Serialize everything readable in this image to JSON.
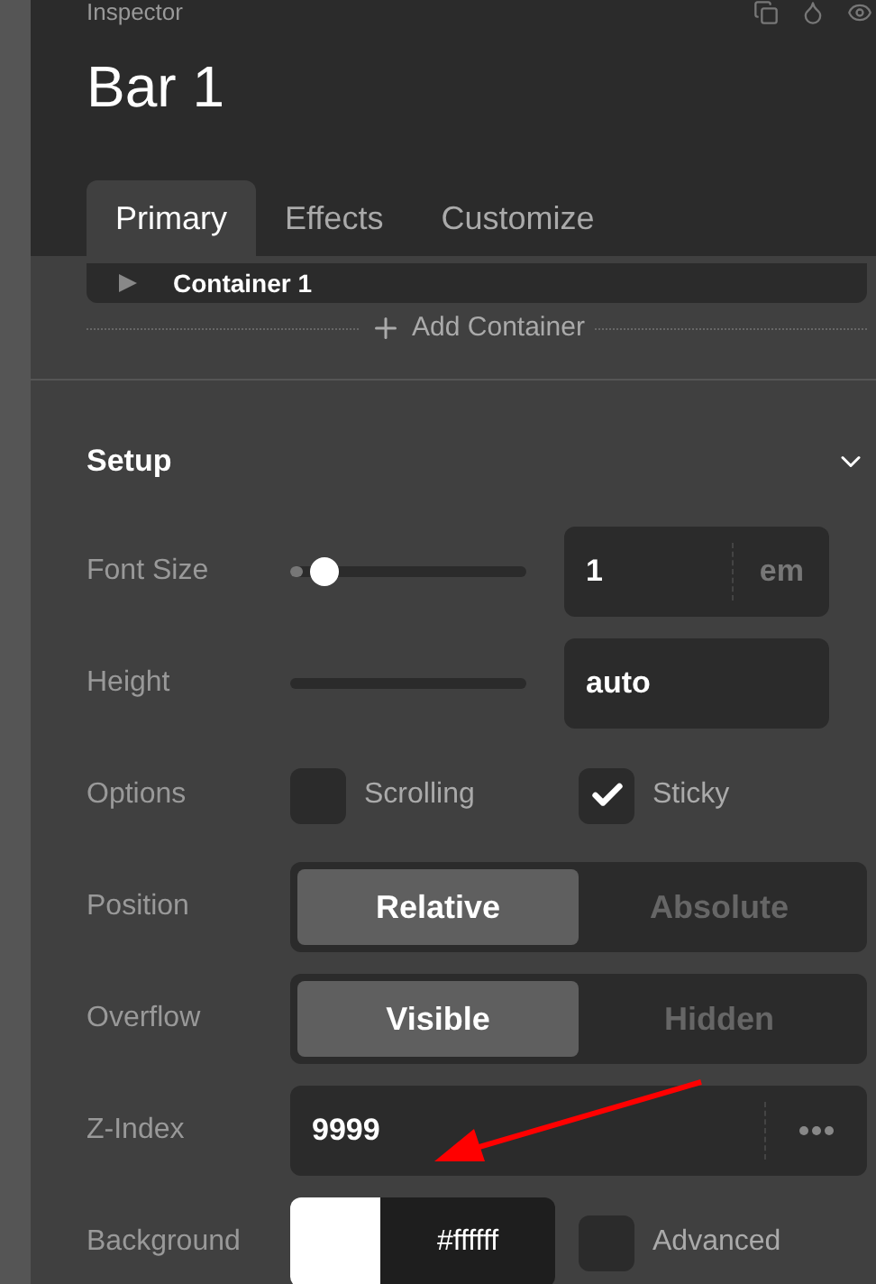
{
  "header": {
    "caption": "Inspector",
    "title": "Bar 1"
  },
  "tabs": [
    {
      "label": "Primary",
      "selected": true
    },
    {
      "label": "Effects",
      "selected": false
    },
    {
      "label": "Customize",
      "selected": false
    }
  ],
  "container": {
    "label": "Container 1",
    "expanded": false
  },
  "add_container": "Add Container",
  "section": {
    "title": "Setup",
    "expanded": true
  },
  "rows": [
    {
      "kind": "slider",
      "label": "Font Size",
      "level": 0.05,
      "value": "1",
      "unit": "em"
    },
    {
      "kind": "slider",
      "label": "Height",
      "value": "auto"
    },
    {
      "kind": "checks",
      "label": "Options",
      "options": [
        {
          "label": "Scrolling",
          "checked": false
        },
        {
          "label": "Sticky",
          "checked": true
        }
      ]
    },
    {
      "kind": "segmented",
      "label": "Position",
      "options": [
        {
          "label": "Relative",
          "selected": true
        },
        {
          "label": "Absolute",
          "selected": false
        }
      ]
    },
    {
      "kind": "segmented",
      "label": "Overflow",
      "options": [
        {
          "label": "Visible",
          "selected": true
        },
        {
          "label": "Hidden",
          "selected": false
        }
      ]
    },
    {
      "kind": "more",
      "label": "Z-Index",
      "value": "9999"
    },
    {
      "kind": "color",
      "label": "Background",
      "color": "#ffffff",
      "value": "#ffffff",
      "option": {
        "label": "Advanced",
        "checked": false
      }
    }
  ]
}
